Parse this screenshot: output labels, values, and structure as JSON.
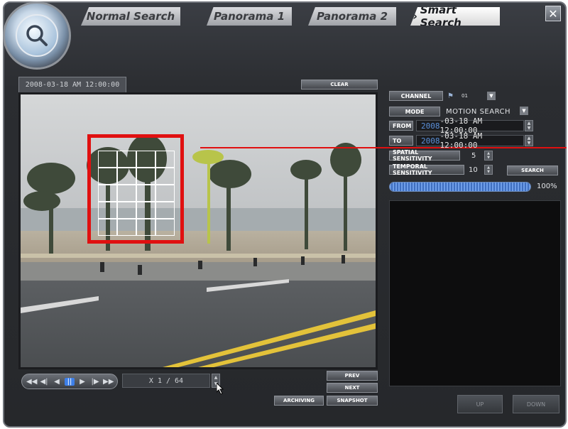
{
  "tabs": [
    {
      "label": "Normal Search",
      "active": false
    },
    {
      "label": "Panorama 1",
      "active": false
    },
    {
      "label": "Panorama 2",
      "active": false
    },
    {
      "label": "Smart Search",
      "active": true
    }
  ],
  "smart_search_prefix": "»",
  "close_label": "✕",
  "video": {
    "timestamp": "2008-03-18 AM 12:00:00",
    "clear_label": "CLEAR",
    "motion_grid": {
      "rows": 5,
      "cols": 4
    }
  },
  "playback": {
    "buttons": [
      "◀◀",
      "◀|",
      "◀",
      "||",
      "▶",
      "|▶",
      "▶▶"
    ],
    "active_button": 3,
    "speed": "X 1 / 64",
    "spin_up": "▲",
    "spin_down": "▼",
    "prev_label": "PREV",
    "next_label": "NEXT",
    "archiving_label": "ARCHIVING",
    "snapshot_label": "SNAPSHOT"
  },
  "search": {
    "channel_label": "CHANNEL",
    "channel_value": "01",
    "mode_label": "MODE",
    "mode_value": "MOTION SEARCH",
    "from_label": "FROM",
    "from_year": "2008",
    "from_rest": "-03-18 AM 12:00:00",
    "to_label": "TO",
    "to_year": "2008",
    "to_rest": "-03-18 AM 12:00:00",
    "spatial_label": "SPATIAL SENSITIVITY",
    "spatial_value": "5",
    "temporal_label": "TEMPORAL SENSITIVITY",
    "temporal_value": "10",
    "search_label": "SEARCH",
    "progress_pct": 100,
    "progress_text": "100%",
    "up_label": "UP",
    "down_label": "DOWN"
  },
  "colors": {
    "accent_red": "#e01010",
    "progress_blue": "#3f6fc0",
    "active_transport": "#3d7fe8"
  }
}
